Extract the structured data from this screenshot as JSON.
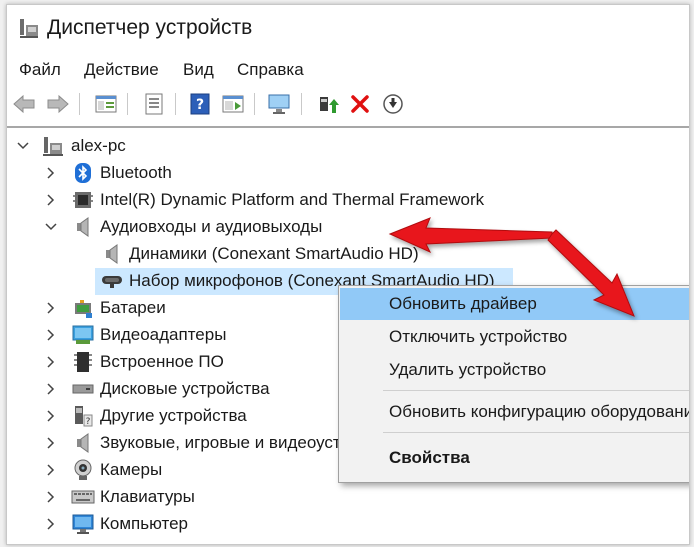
{
  "window": {
    "title": "Диспетчер устройств"
  },
  "menu": {
    "items": [
      "Файл",
      "Действие",
      "Вид",
      "Справка"
    ]
  },
  "tree": {
    "root": "alex-pc",
    "items": [
      {
        "label": "Bluetooth",
        "icon": "bluetooth-icon",
        "expanded": false
      },
      {
        "label": "Intel(R) Dynamic Platform and Thermal Framework",
        "icon": "chip-icon",
        "expanded": false
      },
      {
        "label": "Аудиовходы и аудиовыходы",
        "icon": "speaker-icon",
        "expanded": true
      },
      {
        "label": "Динамики (Conexant SmartAudio HD)",
        "icon": "speaker-icon",
        "child": true
      },
      {
        "label": "Набор микрофонов (Conexant SmartAudio HD)",
        "icon": "microphone-icon",
        "child": true,
        "selected": true
      },
      {
        "label": "Батареи",
        "icon": "battery-icon",
        "expanded": false
      },
      {
        "label": "Видеоадаптеры",
        "icon": "display-adapter-icon",
        "expanded": false
      },
      {
        "label": "Встроенное ПО",
        "icon": "firmware-icon",
        "expanded": false
      },
      {
        "label": "Дисковые устройства",
        "icon": "disk-icon",
        "expanded": false
      },
      {
        "label": "Другие устройства",
        "icon": "other-device-icon",
        "expanded": false
      },
      {
        "label": "Звуковые, игровые и видеоустройства",
        "icon": "speaker-icon",
        "expanded": false
      },
      {
        "label": "Камеры",
        "icon": "camera-icon",
        "expanded": false
      },
      {
        "label": "Клавиатуры",
        "icon": "keyboard-icon",
        "expanded": false
      },
      {
        "label": "Компьютер",
        "icon": "computer-icon",
        "expanded": false
      }
    ]
  },
  "context_menu": {
    "items": [
      {
        "label": "Обновить драйвер",
        "highlighted": true
      },
      {
        "label": "Отключить устройство"
      },
      {
        "label": "Удалить устройство"
      },
      {
        "label": "Обновить конфигурацию оборудования"
      },
      {
        "label": "Свойства",
        "bold": true
      }
    ]
  },
  "colors": {
    "selection": "#cce8ff",
    "menu_highlight": "#91c9f7",
    "arrow": "#e8141c"
  }
}
